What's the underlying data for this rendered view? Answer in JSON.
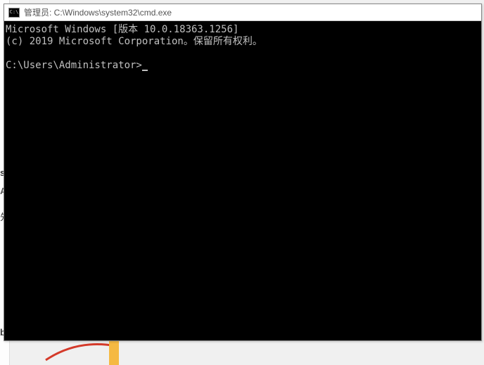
{
  "window": {
    "title": "管理员: C:\\Windows\\system32\\cmd.exe",
    "icon_label": "C:\\"
  },
  "terminal": {
    "line1": "Microsoft Windows [版本 10.0.18363.1256]",
    "line2": "(c) 2019 Microsoft Corporation。保留所有权利。",
    "prompt": "C:\\Users\\Administrator>"
  },
  "background": {
    "char_s": "s",
    "char_A": "A",
    "char_x": "先",
    "char_b": "b"
  }
}
